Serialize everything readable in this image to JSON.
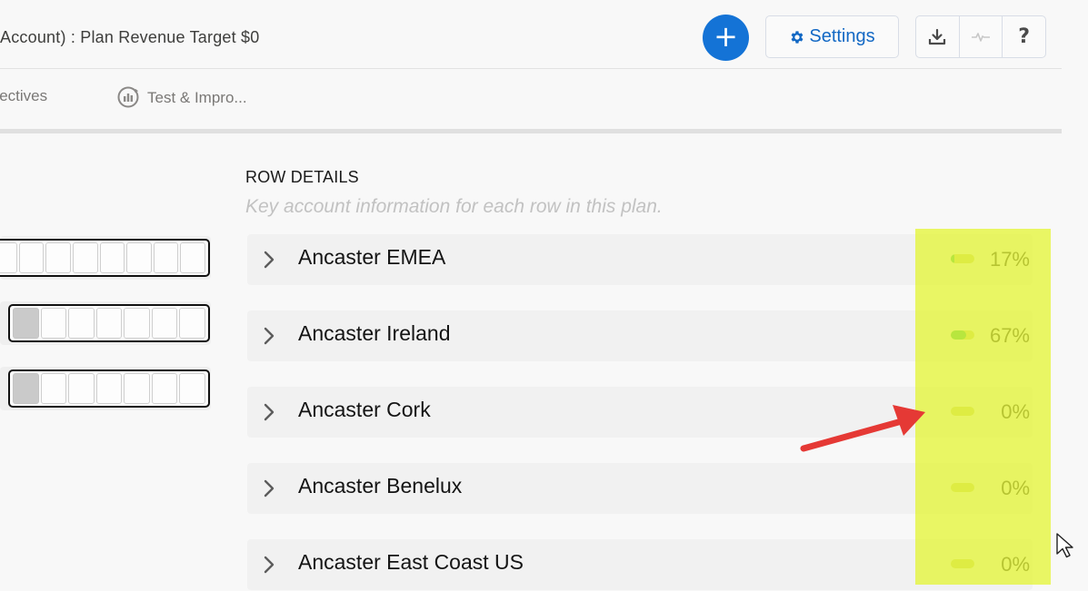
{
  "header": {
    "title": "Account) : Plan Revenue Target $0",
    "add_label": "+",
    "settings_label": "Settings",
    "icons": [
      "download-icon",
      "activity-icon",
      "help-icon"
    ],
    "help_label": "?"
  },
  "tabs": [
    {
      "label": "bjectives"
    },
    {
      "label": "Test & Impro...",
      "icon": "test-improve-icon"
    }
  ],
  "left_bars": [
    {
      "segments": 8,
      "filled_segments": 0
    },
    {
      "segments": 7,
      "filled_segments": 1
    },
    {
      "segments": 7,
      "filled_segments": 1
    }
  ],
  "row_details": {
    "title": "ROW DETAILS",
    "subtitle": "Key account information for each row in this plan.",
    "rows": [
      {
        "name": "Ancaster EMEA",
        "percent": "17%",
        "progress": 0.17
      },
      {
        "name": "Ancaster Ireland",
        "percent": "67%",
        "progress": 0.67
      },
      {
        "name": "Ancaster Cork",
        "percent": "0%",
        "progress": 0
      },
      {
        "name": "Ancaster Benelux",
        "percent": "0%",
        "progress": 0
      },
      {
        "name": "Ancaster East Coast US",
        "percent": "0%",
        "progress": 0
      }
    ]
  },
  "colors": {
    "accent": "#1473d6",
    "settings_text": "#1268c4",
    "progress_fill": "#1db04f",
    "highlight": "#e4f53a",
    "arrow": "#e53935"
  }
}
